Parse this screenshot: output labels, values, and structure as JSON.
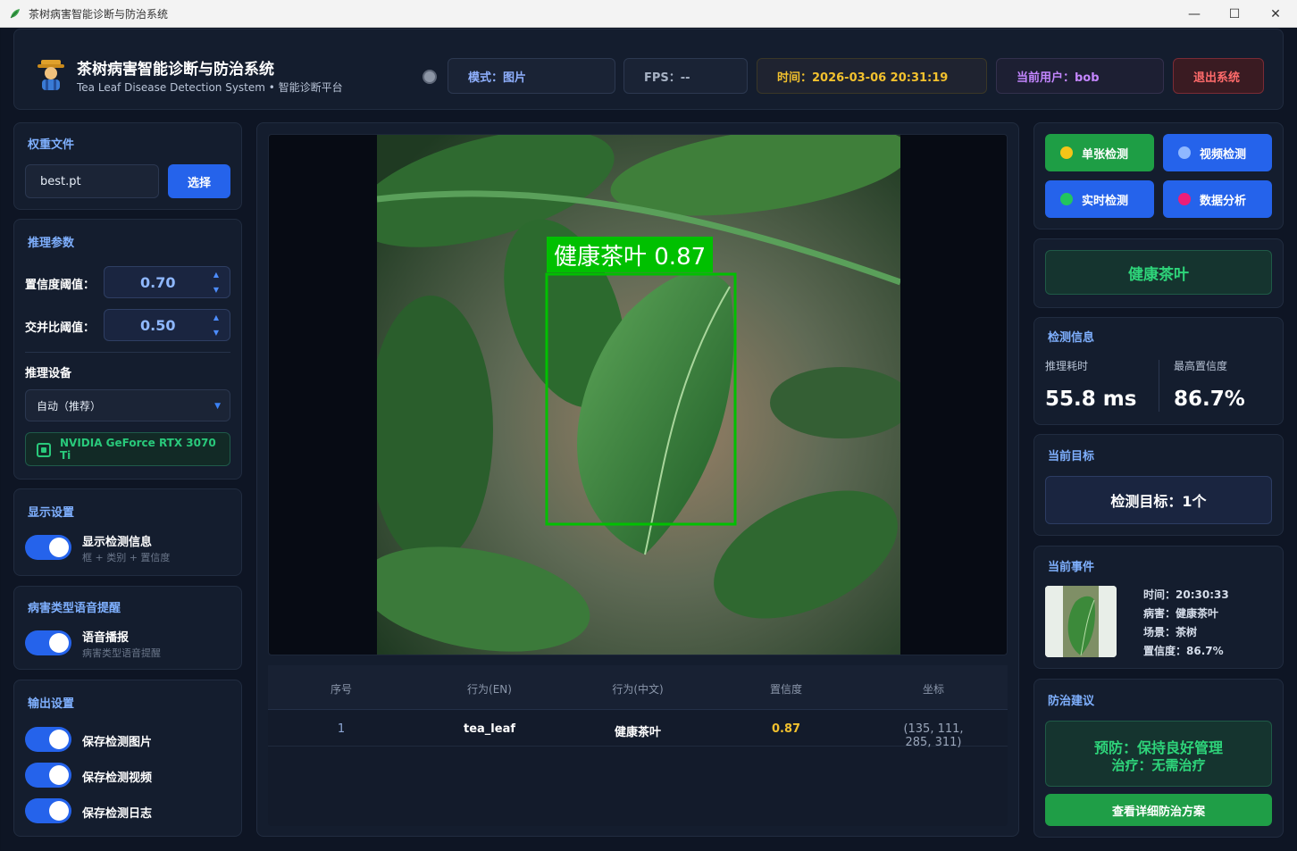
{
  "window": {
    "title": "茶树病害智能诊断与防治系统",
    "min_glyph": "—",
    "max_glyph": "☐",
    "close_glyph": "✕"
  },
  "header": {
    "title": "茶树病害智能诊断与防治系统",
    "subtitle": "Tea Leaf Disease Detection System • 智能诊断平台",
    "mode": "模式：图片",
    "fps": "FPS：--",
    "time": "时间：2026-03-06 20:31:19",
    "user": "当前用户：bob",
    "logout": "退出系统"
  },
  "weights": {
    "title": "权重文件",
    "file": "best.pt",
    "select_label": "选择"
  },
  "inference": {
    "title": "推理参数",
    "conf_label": "置信度阈值：",
    "conf_value": "0.70",
    "iou_label": "交并比阈值：",
    "iou_value": "0.50",
    "device_title": "推理设备",
    "device_value": "自动（推荐）",
    "gpu_name": "NVIDIA GeForce RTX 3070 Ti"
  },
  "display": {
    "title": "显示设置",
    "toggle_label": "显示检测信息",
    "toggle_sub": "框 + 类别 + 置信度"
  },
  "voice": {
    "title": "病害类型语音提醒",
    "toggle_label": "语音播报",
    "toggle_sub": "病害类型语音提醒"
  },
  "output": {
    "title": "输出设置",
    "items": [
      "保存检测图片",
      "保存检测视频",
      "保存检测日志"
    ]
  },
  "detection_overlay": {
    "label": "健康茶叶 0.87"
  },
  "table": {
    "headers": [
      "序号",
      "行为(EN)",
      "行为(中文)",
      "置信度",
      "坐标"
    ],
    "rows": [
      [
        "1",
        "tea_leaf",
        "健康茶叶",
        "0.87",
        "(135, 111, 285, 311)"
      ]
    ]
  },
  "modes": {
    "single": "单张检测",
    "video": "视频检测",
    "realtime": "实时检测",
    "analysis": "数据分析"
  },
  "result": {
    "label": "健康茶叶"
  },
  "detect_info": {
    "title": "检测信息",
    "time_label": "推理耗时",
    "time_value": "55.8 ms",
    "conf_label": "最高置信度",
    "conf_value": "86.7%"
  },
  "current_target": {
    "title": "当前目标",
    "value": "检测目标：1个"
  },
  "current_event": {
    "title": "当前事件",
    "time": "时间：20:30:33",
    "disease": "病害：健康茶叶",
    "scene": "场景：茶树",
    "confidence": "置信度：86.7%"
  },
  "advice": {
    "title": "防治建议",
    "prevent": "预防：保持良好管理",
    "treat": "治疗：无需治疗",
    "detail_button": "查看详细防治方案"
  },
  "colors": {
    "accent_blue": "#2563eb",
    "success_green": "#2ed47a",
    "detection_box": "#00c000",
    "time_yellow": "#f2c12e",
    "user_purple": "#c486ff",
    "logout_red": "#ff6b6b"
  }
}
